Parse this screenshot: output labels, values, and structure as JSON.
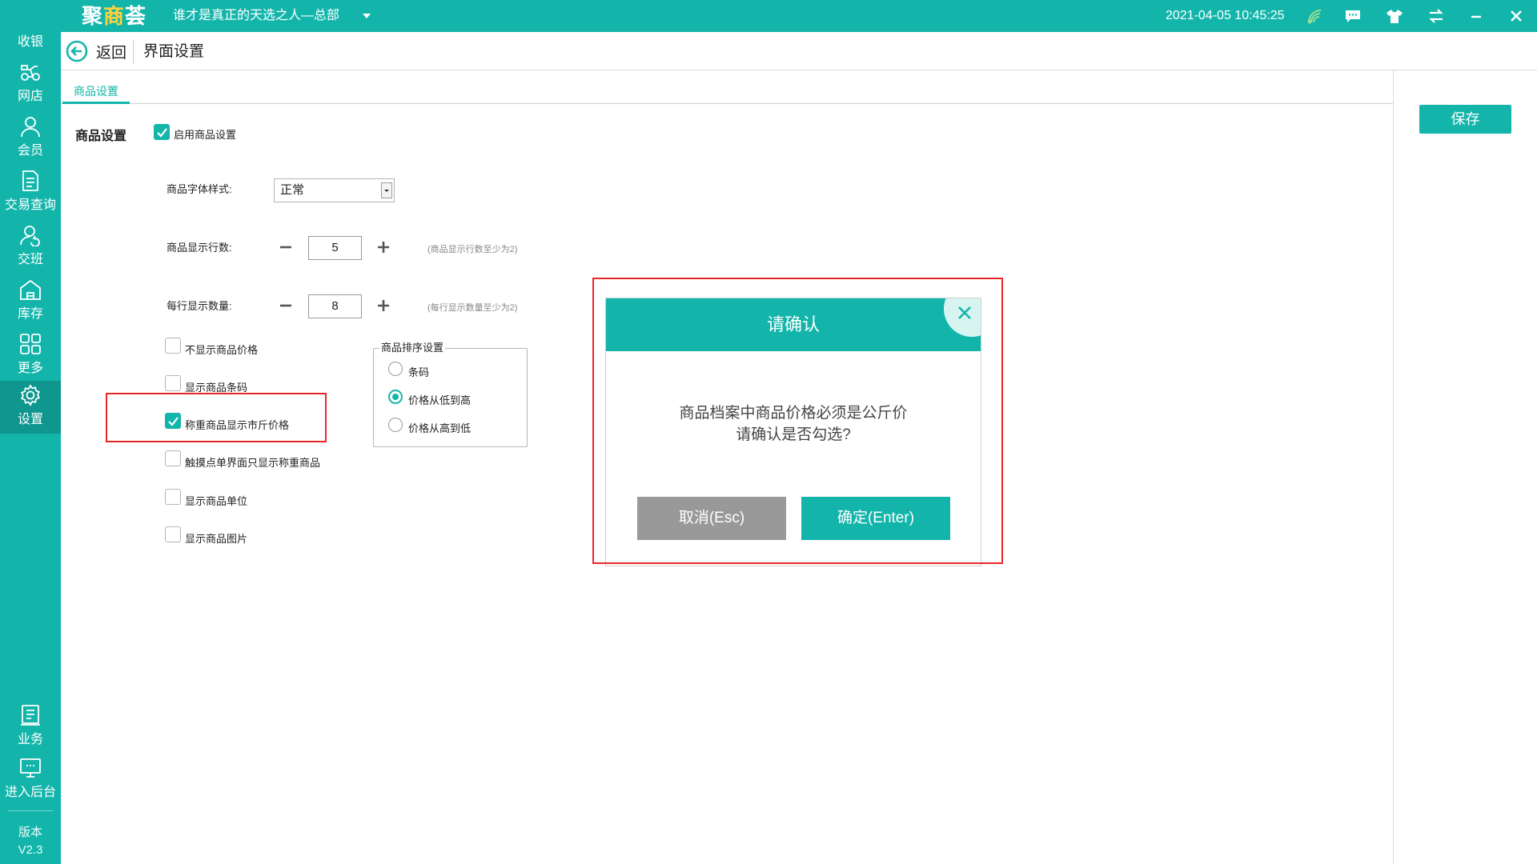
{
  "app": {
    "logo_part1": "聚",
    "logo_part2": "商",
    "logo_part3": "荟",
    "store_name": "谁才是真正的天选之人—总部",
    "datetime": "2021-04-05 10:45:25",
    "accent_color": "#13b5ab"
  },
  "sidebar": {
    "items": [
      {
        "label": "收银",
        "icon": "cash-register-icon"
      },
      {
        "label": "网店",
        "icon": "scooter-icon"
      },
      {
        "label": "会员",
        "icon": "user-icon"
      },
      {
        "label": "交易查询",
        "icon": "document-icon"
      },
      {
        "label": "交班",
        "icon": "shift-handover-icon"
      },
      {
        "label": "库存",
        "icon": "warehouse-icon"
      },
      {
        "label": "更多",
        "icon": "grid-icon"
      },
      {
        "label": "设置",
        "icon": "gear-icon"
      },
      {
        "label": "业务",
        "icon": "business-icon"
      },
      {
        "label": "进入后台",
        "icon": "monitor-icon"
      }
    ],
    "version_label": "版本",
    "version": "V2.3"
  },
  "header": {
    "back_label": "返回",
    "title": "界面设置"
  },
  "tabs": [
    {
      "label": "商品设置"
    }
  ],
  "save_label": "保存",
  "settings": {
    "section_label": "商品设置",
    "enable_label": "启用商品设置",
    "font_style_label": "商品字体样式:",
    "font_style_value": "正常",
    "rows_label": "商品显示行数:",
    "rows_value": "5",
    "rows_hint": "(商品显示行数至少为2)",
    "per_row_label": "每行显示数量:",
    "per_row_value": "8",
    "per_row_hint": "(每行显示数量至少为2)",
    "options": [
      {
        "label": "不显示商品价格",
        "checked": false
      },
      {
        "label": "显示商品条码",
        "checked": false
      },
      {
        "label": "称重商品显示市斤价格",
        "checked": true
      },
      {
        "label": "触摸点单界面只显示称重商品",
        "checked": false
      },
      {
        "label": "显示商品单位",
        "checked": false
      },
      {
        "label": "显示商品图片",
        "checked": false
      }
    ],
    "sort": {
      "legend": "商品排序设置",
      "options": [
        {
          "label": "条码",
          "selected": false
        },
        {
          "label": "价格从低到高",
          "selected": true
        },
        {
          "label": "价格从高到低",
          "selected": false
        }
      ]
    }
  },
  "dialog": {
    "title": "请确认",
    "message_line1": "商品档案中商品价格必须是公斤价",
    "message_line2": "请确认是否勾选?",
    "cancel_label": "取消(Esc)",
    "ok_label": "确定(Enter)"
  }
}
